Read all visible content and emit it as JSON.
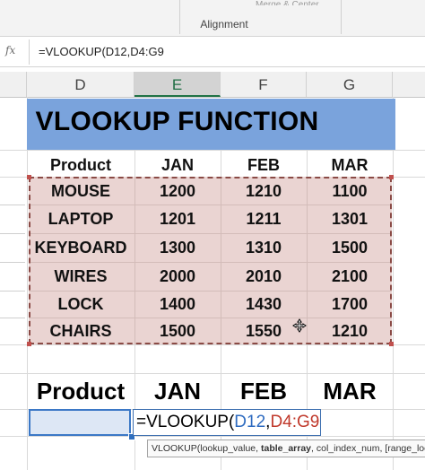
{
  "ribbon": {
    "group_label": "Alignment",
    "merge_stub": "Merge & Center"
  },
  "formula_bar": {
    "fx_label": "fx",
    "text": "=VLOOKUP(D12,D4:G9"
  },
  "columns": [
    "D",
    "E",
    "F",
    "G"
  ],
  "selected_column": "E",
  "title": "VLOOKUP FUNCTION",
  "table": {
    "headers": [
      "Product",
      "JAN",
      "FEB",
      "MAR"
    ],
    "rows": [
      [
        "MOUSE",
        "1200",
        "1210",
        "1100"
      ],
      [
        "LAPTOP",
        "1201",
        "1211",
        "1301"
      ],
      [
        "KEYBOARD",
        "1300",
        "1310",
        "1500"
      ],
      [
        "WIRES",
        "2000",
        "2010",
        "2100"
      ],
      [
        "LOCK",
        "1400",
        "1430",
        "1700"
      ],
      [
        "CHAIRS",
        "1500",
        "1550",
        "1210"
      ]
    ]
  },
  "lookup_headers": [
    "Product",
    "JAN",
    "FEB",
    "MAR"
  ],
  "edit_cell": {
    "prefix": "=VLOOKUP(",
    "ref1": "D12",
    "sep": ",",
    "ref2": "D4:G9"
  },
  "tooltip": {
    "fn": "VLOOKUP(lookup_value, ",
    "active_arg": "table_array",
    "rest": ", col_index_num, [range_lookup])"
  },
  "colors": {
    "title_band": "#7aa3dc",
    "data_fill": "#ead4d2",
    "selection": "#3b78c6",
    "ref_blue": "#2e6bc0",
    "ref_red": "#c0392b"
  }
}
